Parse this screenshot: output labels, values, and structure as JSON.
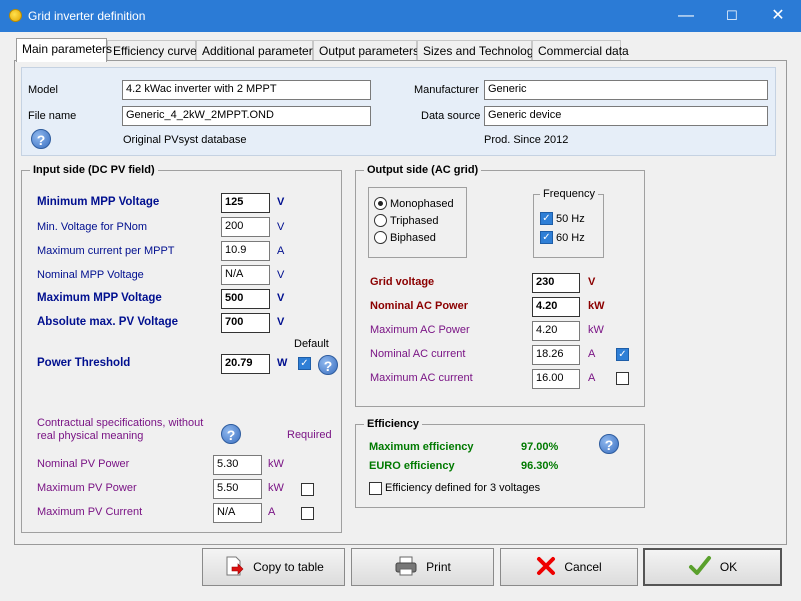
{
  "window": {
    "title": "Grid inverter definition",
    "minimize": "—",
    "maximize": "☐",
    "close": "✕"
  },
  "tabs": [
    {
      "label": "Main parameters"
    },
    {
      "label": "Efficiency curve"
    },
    {
      "label": "Additional parameters"
    },
    {
      "label": "Output parameters"
    },
    {
      "label": "Sizes and Technology"
    },
    {
      "label": "Commercial data"
    }
  ],
  "header": {
    "model_label": "Model",
    "model_value": "4.2 kWac inverter with 2 MPPT",
    "filename_label": "File name",
    "filename_value": "Generic_4_2kW_2MPPT.OND",
    "manufacturer_label": "Manufacturer",
    "manufacturer_value": "Generic",
    "datasource_label": "Data source",
    "datasource_value": "Generic device",
    "database_text": "Original PVsyst database",
    "prod_text": "Prod. Since 2012",
    "help": "?"
  },
  "input_side": {
    "title": "Input side (DC PV field)",
    "rows": [
      {
        "label": "Minimum MPP Voltage",
        "value": "125",
        "unit": "V"
      },
      {
        "label": "Min. Voltage for PNom",
        "value": "200",
        "unit": "V"
      },
      {
        "label": "Maximum current per MPPT",
        "value": "10.9",
        "unit": "A"
      },
      {
        "label": "Nominal MPP Voltage",
        "value": "N/A",
        "unit": "V"
      },
      {
        "label": "Maximum MPP Voltage",
        "value": "500",
        "unit": "V"
      },
      {
        "label": "Absolute max. PV Voltage",
        "value": "700",
        "unit": "V"
      }
    ],
    "threshold": {
      "label": "Power Threshold",
      "value": "20.79",
      "unit": "W",
      "default_label": "Default"
    },
    "contract_text": "Contractual specifications, without real physical meaning",
    "required_label": "Required",
    "contract_rows": [
      {
        "label": "Nominal PV Power",
        "value": "5.30",
        "unit": "kW"
      },
      {
        "label": "Maximum PV Power",
        "value": "5.50",
        "unit": "kW"
      },
      {
        "label": "Maximum PV Current",
        "value": "N/A",
        "unit": "A"
      }
    ]
  },
  "output_side": {
    "title": "Output side (AC grid)",
    "phases": [
      {
        "label": "Monophased",
        "selected": true
      },
      {
        "label": "Triphased",
        "selected": false
      },
      {
        "label": "Biphased",
        "selected": false
      }
    ],
    "frequency": {
      "title": "Frequency",
      "options": [
        {
          "label": "50 Hz",
          "checked": true
        },
        {
          "label": "60 Hz",
          "checked": true
        }
      ]
    },
    "rows": [
      {
        "label": "Grid voltage",
        "value": "230",
        "unit": "V"
      },
      {
        "label": "Nominal AC Power",
        "value": "4.20",
        "unit": "kW"
      },
      {
        "label": "Maximum AC Power",
        "value": "4.20",
        "unit": "kW"
      },
      {
        "label": "Nominal AC current",
        "value": "18.26",
        "unit": "A"
      },
      {
        "label": "Maximum AC current",
        "value": "16.00",
        "unit": "A"
      }
    ]
  },
  "efficiency": {
    "title": "Efficiency",
    "max_label": "Maximum efficiency",
    "max_value": "97.00%",
    "euro_label": "EURO efficiency",
    "euro_value": "96.30%",
    "three_voltages_label": "Efficiency defined for 3 voltages"
  },
  "buttons": {
    "copy": "Copy to table",
    "print": "Print",
    "cancel": "Cancel",
    "ok": "OK"
  },
  "colors": {
    "titlebar": "#2b7bd6",
    "navy": "#000f8f",
    "purple": "#7a1485",
    "darkred": "#8b0000",
    "green": "#007a00"
  }
}
